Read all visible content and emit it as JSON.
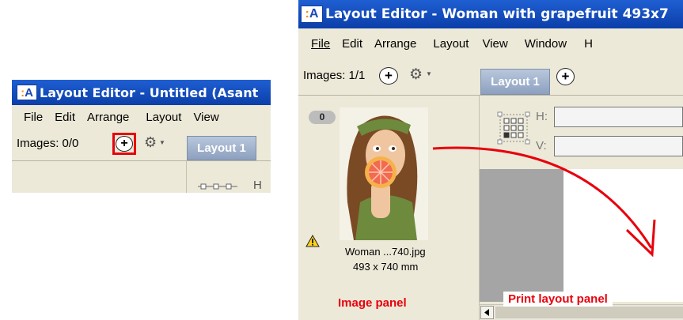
{
  "small_window": {
    "title": "Layout Editor - Untitled (Asant",
    "logo": ":A",
    "menu": [
      "File",
      "Edit",
      "Arrange",
      "Layout",
      "View"
    ],
    "images_label": "Images: 0/0",
    "tab_label": "Layout 1",
    "h_label": "H",
    "highlight_color": "#e8000c"
  },
  "large_window": {
    "title": "Layout Editor - Woman with grapefruit 493x7",
    "logo": ":A",
    "menu": [
      "File",
      "Edit",
      "Arrange",
      "Layout",
      "View",
      "Window",
      "H"
    ],
    "images_label": "Images: 1/1",
    "tab_label": "Layout 1",
    "image_index_badge": "0",
    "image_caption": "Woman ...740.jpg",
    "image_size": "493 x 740 mm",
    "h_label": "H:",
    "v_label": "V:",
    "warning_icon": "warning-icon"
  },
  "annotations": {
    "image_panel": "Image panel",
    "print_layout_panel": "Print layout panel",
    "arrow_color": "#e8000c"
  }
}
